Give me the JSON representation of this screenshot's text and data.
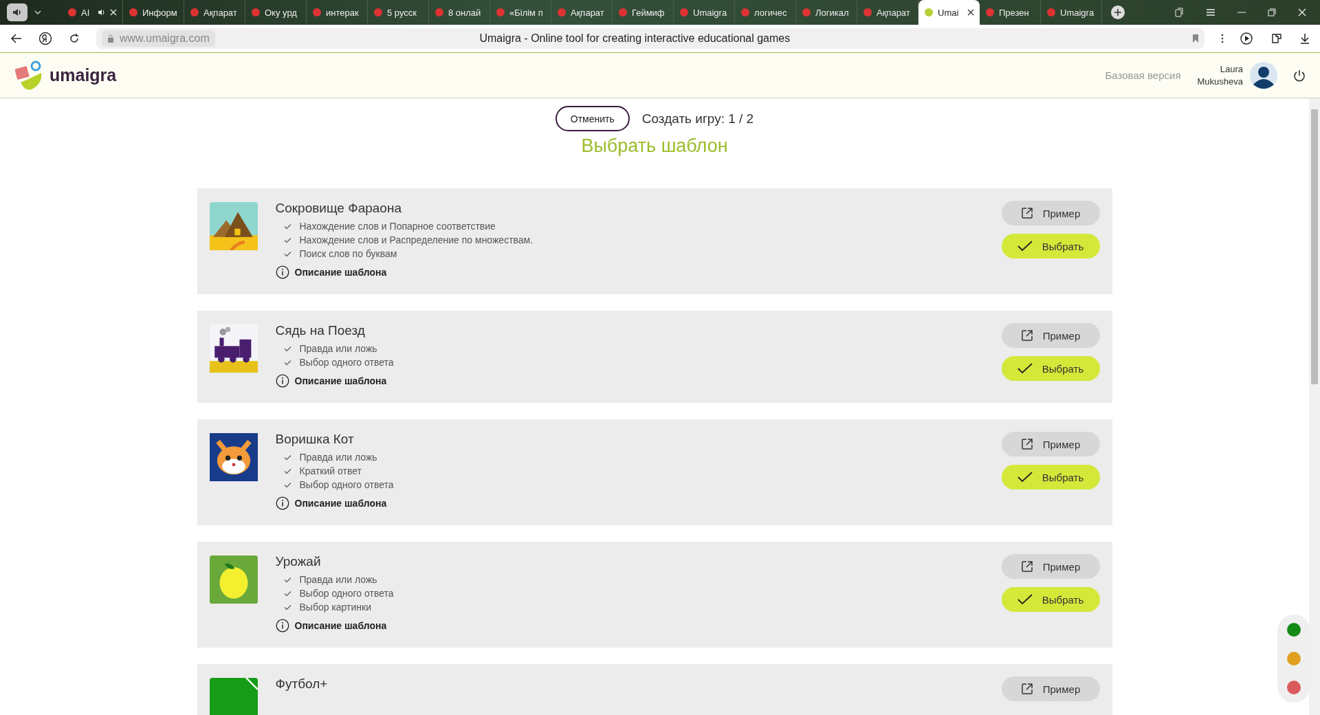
{
  "browser": {
    "tabs": [
      {
        "title": "AI",
        "selected": false,
        "audio": true
      },
      {
        "title": "Информ",
        "selected": false,
        "audio": false
      },
      {
        "title": "Ақпарат",
        "selected": false,
        "audio": false
      },
      {
        "title": "Оку урд",
        "selected": false,
        "audio": false
      },
      {
        "title": "интерак",
        "selected": false,
        "audio": false
      },
      {
        "title": "5 русск",
        "selected": false,
        "audio": false
      },
      {
        "title": "8 онлай",
        "selected": false,
        "audio": false
      },
      {
        "title": "«Білім п",
        "selected": false,
        "audio": false
      },
      {
        "title": "Ақпарат",
        "selected": false,
        "audio": false
      },
      {
        "title": "Геймиф",
        "selected": false,
        "audio": false
      },
      {
        "title": "Umaigra",
        "selected": false,
        "audio": false
      },
      {
        "title": "логичес",
        "selected": false,
        "audio": false
      },
      {
        "title": "Логикал",
        "selected": false,
        "audio": false
      },
      {
        "title": "Ақпарат",
        "selected": false,
        "audio": false
      },
      {
        "title": "Umai",
        "selected": true,
        "audio": false
      },
      {
        "title": "Презен",
        "selected": false,
        "audio": false
      },
      {
        "title": "Umaigra",
        "selected": false,
        "audio": false
      }
    ],
    "url": "www.umaigra.com",
    "page_title": "Umaigra - Online tool for creating interactive educational games"
  },
  "header": {
    "logo": "umaigra",
    "version": "Базовая версия",
    "user_first": "Laura",
    "user_last": "Mukusheva"
  },
  "wizard": {
    "cancel": "Отменить",
    "step": "Создать игру: 1 / 2",
    "heading": "Выбрать шаблон"
  },
  "templates": [
    {
      "kind": "pyramids",
      "title": "Сокровище Фараона",
      "features": [
        "Нахождение слов и Попарное соответствие",
        "Нахождение слов и Распределение по множествам.",
        "Поиск слов по буквам"
      ],
      "description": "Описание шаблона",
      "example": "Пример",
      "select": "Выбрать"
    },
    {
      "kind": "train",
      "title": "Сядь на Поезд",
      "features": [
        "Правда или ложь",
        "Выбор одного ответа"
      ],
      "description": "Описание шаблона",
      "example": "Пример",
      "select": "Выбрать"
    },
    {
      "kind": "cat",
      "title": "Воришка Кот",
      "features": [
        "Правда или ложь",
        "Краткий ответ",
        "Выбор одного ответа"
      ],
      "description": "Описание шаблона",
      "example": "Пример",
      "select": "Выбрать"
    },
    {
      "kind": "apple",
      "title": "Урожай",
      "features": [
        "Правда или ложь",
        "Выбор одного ответа",
        "Выбор картинки"
      ],
      "description": "Описание шаблона",
      "example": "Пример",
      "select": "Выбрать"
    },
    {
      "kind": "field",
      "title": "Футбол+",
      "example": "Пример"
    }
  ],
  "status_dots": [
    {
      "color": "#168a16"
    },
    {
      "color": "#e0a020"
    },
    {
      "color": "#d95b5b"
    }
  ]
}
